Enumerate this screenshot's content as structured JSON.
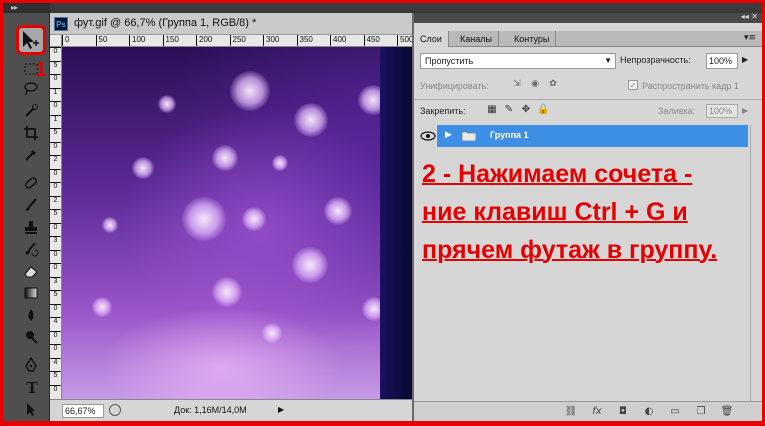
{
  "document": {
    "ps_badge": "Ps",
    "title": "фут.gif @ 66,7% (Группа 1, RGB/8) *",
    "ruler_top": [
      "0",
      "50",
      "100",
      "150",
      "200",
      "250",
      "300",
      "350",
      "400",
      "450",
      "500"
    ],
    "ruler_left": [
      "0",
      "5",
      "0",
      "1",
      "0",
      "1",
      "5",
      "0",
      "2",
      "0",
      "0",
      "2",
      "5",
      "0",
      "3",
      "0",
      "0",
      "3",
      "5",
      "0",
      "4",
      "0",
      "0",
      "4",
      "5",
      "0"
    ],
    "zoom": "66,67%",
    "info": "Док: 1,16M/14,0M",
    "status_arrow": "▶"
  },
  "tools": {
    "grip": "▸▸",
    "step_label": "1",
    "items": [
      "marquee",
      "lasso",
      "quick-select",
      "crop",
      "eyedropper",
      "healing",
      "brush",
      "stamp",
      "history-brush",
      "eraser",
      "gradient",
      "blur",
      "dodge",
      "pen",
      "type",
      "path-select"
    ]
  },
  "layers_panel": {
    "window_controls": "◂◂  ✕",
    "tabs": [
      "Слои",
      "Каналы",
      "Контуры"
    ],
    "active_tab": 0,
    "menu_icon": "▾≡",
    "blend_mode": "Пропустить",
    "opacity_label": "Непрозрачность:",
    "opacity_value": "100%",
    "unify_label": "Унифицировать:",
    "propagate_label": "Распространить кадр 1",
    "lock_label": "Закрепить:",
    "fill_label": "Заливка:",
    "fill_value": "100%",
    "layer": {
      "name": "Группа 1",
      "visible": true,
      "selected_color": "#3d8fe6"
    },
    "instruction_lines": [
      "2 - Нажимаем сочета -",
      "ние клавиш Ctrl + G и",
      "прячем футаж в группу."
    ],
    "instruction_color": "#e60000",
    "footer_icons": [
      "link-icon",
      "fx-icon",
      "mask-icon",
      "adjustment-icon",
      "folder-icon",
      "new-layer-icon",
      "trash-icon"
    ],
    "footer_glyphs": [
      "⛓",
      "fx",
      "◘",
      "◐",
      "▭",
      "❐",
      "🗑"
    ]
  }
}
